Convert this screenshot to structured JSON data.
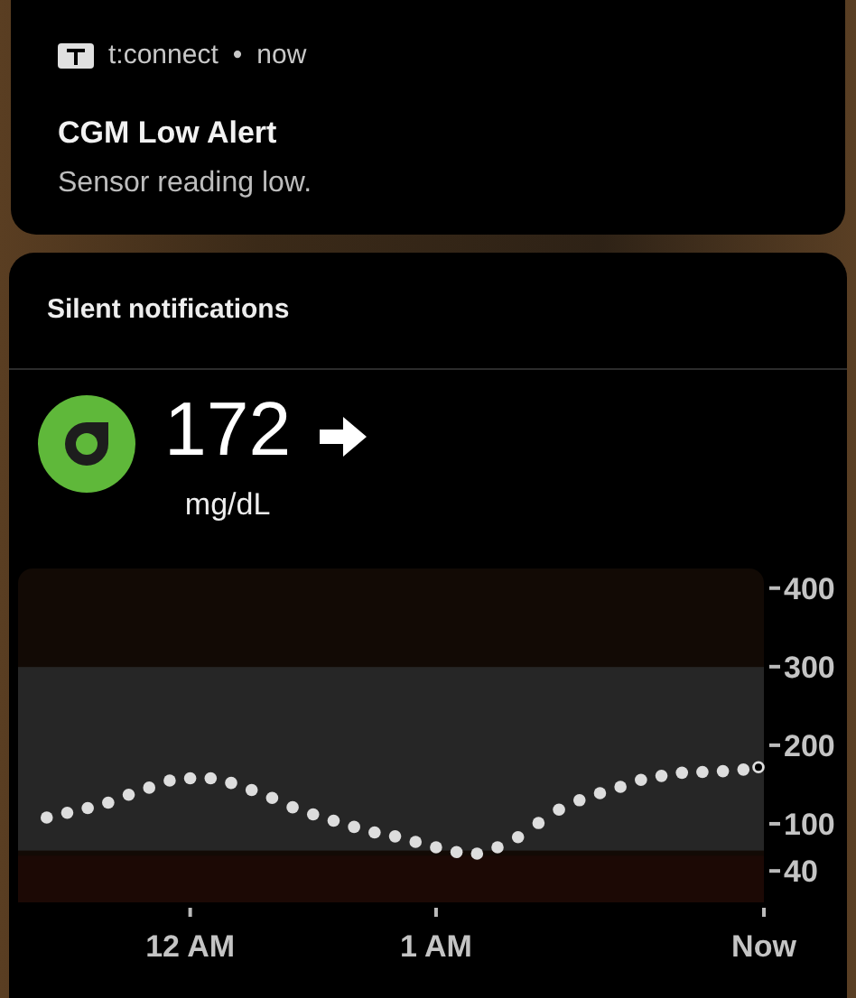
{
  "notification": {
    "app_name": "t:connect",
    "separator": "•",
    "time": "now",
    "title": "CGM Low Alert",
    "text": "Sensor reading low."
  },
  "silent_section": {
    "header": "Silent notifications",
    "reading": {
      "value": "172",
      "unit": "mg/dL"
    },
    "chart_data": {
      "type": "scatter",
      "categories": [
        null,
        null,
        null,
        null,
        null,
        null,
        null,
        "12 AM",
        null,
        null,
        null,
        null,
        null,
        null,
        null,
        null,
        null,
        null,
        null,
        "1 AM",
        null,
        null,
        null,
        null,
        null,
        null,
        null,
        null,
        null,
        null,
        null,
        null,
        null,
        null,
        null,
        "Now"
      ],
      "series": [
        {
          "color": "#dddddd",
          "values": [
            108,
            114,
            120,
            127,
            137,
            146,
            155,
            158,
            158,
            152,
            143,
            133,
            121,
            112,
            104,
            96,
            89,
            84,
            77,
            70,
            64,
            62,
            70,
            83,
            101,
            118,
            130,
            139,
            147,
            156,
            161,
            165,
            166,
            167,
            169,
            172
          ]
        }
      ],
      "ylim": [
        0,
        425
      ],
      "yticks": [
        40,
        100,
        200,
        300,
        400
      ]
    }
  }
}
